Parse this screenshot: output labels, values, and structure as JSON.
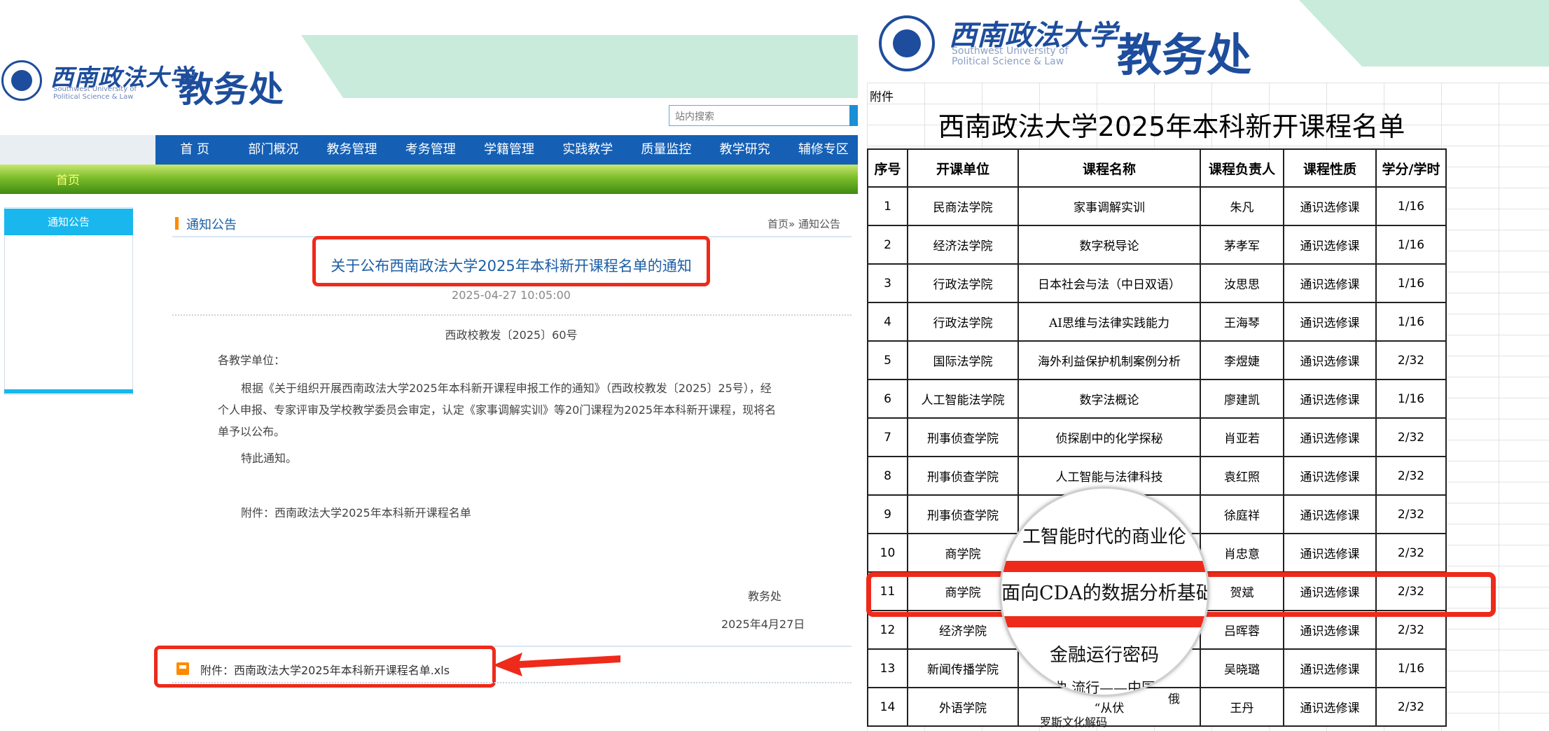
{
  "left": {
    "logo_cn": "西南政法大学",
    "logo_en_lines": [
      "Southwest University of",
      "Political Science & Law"
    ],
    "dept_title": "教务处",
    "search_placeholder": "站内搜索",
    "nav": [
      "首 页",
      "部门概况",
      "教务管理",
      "考务管理",
      "学籍管理",
      "实践教学",
      "质量监控",
      "教学研究",
      "辅修专区"
    ],
    "crumb_home": "首页",
    "sidebar_tab": "通知公告",
    "section_title": "通知公告",
    "section_crumb": "首页» 通知公告",
    "notice_title": "关于公布西南政法大学2025年本科新开课程名单的通知",
    "notice_date": "2025-04-27 10:05:00",
    "doc_number": "西政校教发〔2025〕60号",
    "salutation": "各教学单位：",
    "body_lines": [
      "根据《关于组织开展西南政法大学2025年本科新开课程申报工作的通知》（西政校教发〔2025〕25号），经",
      "个人申报、专家评审及学校教学委员会审定，认定《家事调解实训》等20门课程为2025年本科新开课程，现将名",
      "单予以公布。"
    ],
    "closing": "特此通知。",
    "attachment_line": "附件：西南政法大学2025年本科新开课程名单",
    "sign_dept": "教务处",
    "sign_date": "2025年4月27日",
    "attachment_link": "附件：西南政法大学2025年本科新开课程名单.xls"
  },
  "right": {
    "logo_cn": "西南政法大学",
    "logo_en_lines": [
      "Southwest University of",
      "Political Science & Law"
    ],
    "dept_title": "教务处",
    "attachment_cell": "附件",
    "sheet_title": "西南政法大学2025年本科新开课程名单",
    "columns": [
      "序号",
      "开课单位",
      "课程名称",
      "课程负责人",
      "课程性质",
      "学分/学时"
    ],
    "rows": [
      [
        "1",
        "民商法学院",
        "家事调解实训",
        "朱凡",
        "通识选修课",
        "1/16"
      ],
      [
        "2",
        "经济法学院",
        "数字税导论",
        "茅孝军",
        "通识选修课",
        "1/16"
      ],
      [
        "3",
        "行政法学院",
        "日本社会与法（中日双语）",
        "汝思思",
        "通识选修课",
        "1/16"
      ],
      [
        "4",
        "行政法学院",
        "AI思维与法律实践能力",
        "王海琴",
        "通识选修课",
        "1/16"
      ],
      [
        "5",
        "国际法学院",
        "海外利益保护机制案例分析",
        "李煜婕",
        "通识选修课",
        "2/32"
      ],
      [
        "6",
        "人工智能法学院",
        "数字法概论",
        "廖建凯",
        "通识选修课",
        "1/16"
      ],
      [
        "7",
        "刑事侦查学院",
        "侦探剧中的化学探秘",
        "肖亚若",
        "通识选修课",
        "2/32"
      ],
      [
        "8",
        "刑事侦查学院",
        "人工智能与法律科技",
        "袁红照",
        "通识选修课",
        "2/32"
      ],
      [
        "9",
        "刑事侦查学院",
        "",
        "徐庭祥",
        "通识选修课",
        "2/32"
      ],
      [
        "10",
        "商学院",
        "",
        "肖忠意",
        "通识选修课",
        "2/32"
      ],
      [
        "11",
        "商学院",
        "",
        "贺斌",
        "通识选修课",
        "2/32"
      ],
      [
        "12",
        "经济学院",
        "",
        "吕晖蓉",
        "通识选修课",
        "2/32"
      ],
      [
        "13",
        "新闻传播学院",
        "",
        "吴晓璐",
        "通识选修课",
        "1/16"
      ],
      [
        "14",
        "外语学院",
        "“从伏",
        "王丹",
        "通识选修课",
        "2/32"
      ]
    ],
    "row14_tail": "俄",
    "magnifier_lines": [
      "工智能时代的商业伦",
      "面向CDA的数据分析基础",
      "金融运行密码",
      "曲 流行——中国",
      "罗斯文化解码"
    ]
  },
  "colors": {
    "brand_blue": "#1d4d9c",
    "nav_blue": "#1560b5",
    "highlight_red": "#ee2a1b",
    "accent_orange": "#ff8a00"
  }
}
